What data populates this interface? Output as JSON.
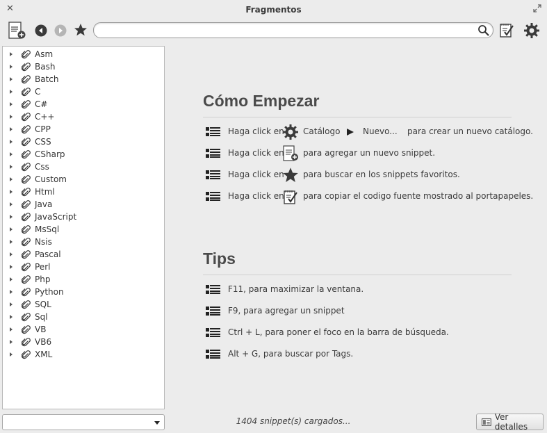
{
  "window": {
    "title": "Fragmentos"
  },
  "search": {
    "value": "",
    "placeholder": ""
  },
  "sidebar": {
    "items": [
      "Asm",
      "Bash",
      "Batch",
      "C",
      "C#",
      "C++",
      "CPP",
      "CSS",
      "CSharp",
      "Css",
      "Custom",
      "Html",
      "Java",
      "JavaScript",
      "MsSql",
      "Nsis",
      "Pascal",
      "Perl",
      "Php",
      "Python",
      "SQL",
      "Sql",
      "VB",
      "VB6",
      "XML"
    ]
  },
  "catalog_combo": {
    "value": ""
  },
  "getting_started": {
    "title": "Cómo Empezar",
    "rows": [
      {
        "prefix": "Haga click en",
        "catalog": "Catálogo",
        "nuevo": "Nuevo...",
        "suffix": "para crear un nuevo catálogo."
      },
      {
        "prefix": "Haga click en",
        "suffix": "para agregar un nuevo snippet."
      },
      {
        "prefix": "Haga click en",
        "suffix": "para buscar en los snippets favoritos."
      },
      {
        "prefix": "Haga click en",
        "suffix": "para copiar el codigo fuente mostrado al portapapeles."
      }
    ]
  },
  "tips": {
    "title": "Tips",
    "items": [
      "F11, para maximizar la ventana.",
      "F9, para agregar un snippet",
      "Ctrl + L, para poner el foco en la barra de búsqueda.",
      "Alt + G, para buscar por Tags."
    ]
  },
  "status": {
    "text": "1404 snippet(s) cargados..."
  },
  "details_button": {
    "label": "Ver detalles"
  }
}
